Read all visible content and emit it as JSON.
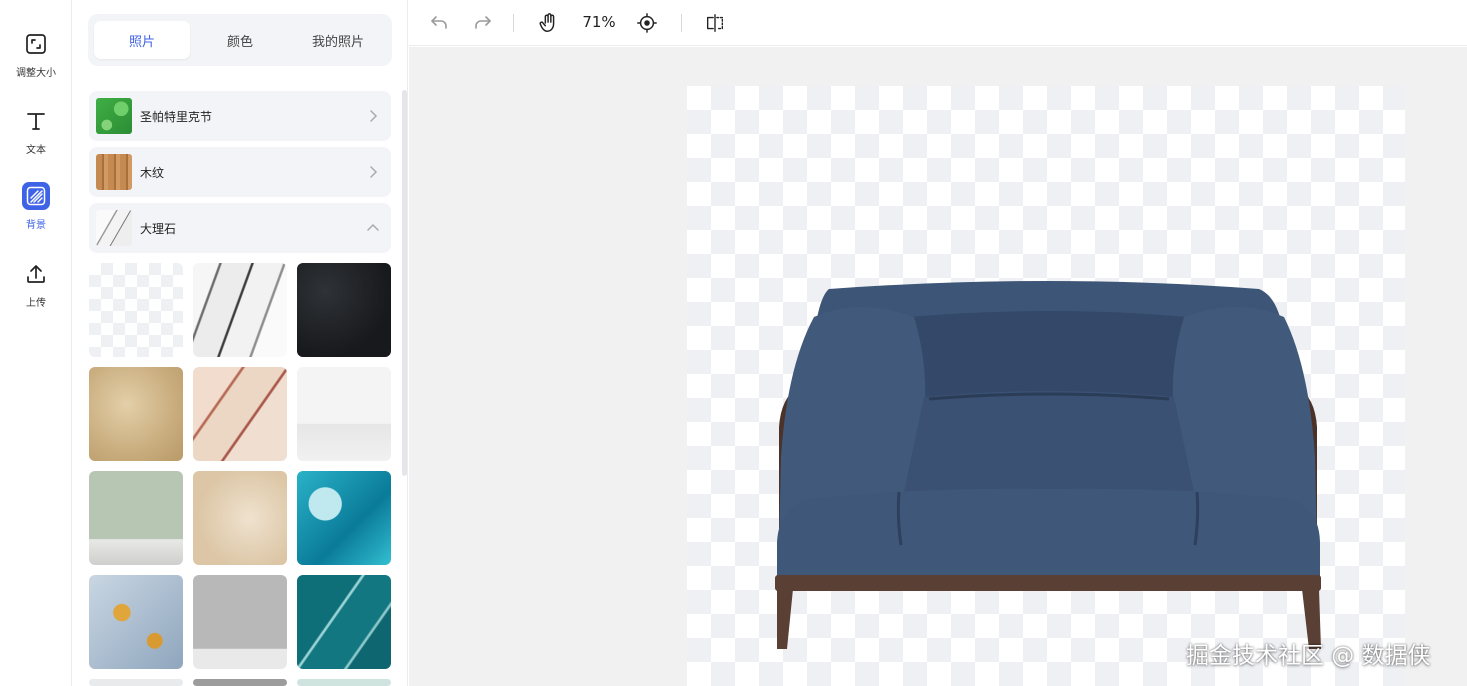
{
  "rail": {
    "items": [
      {
        "label": "调整大小",
        "icon": "resize-icon"
      },
      {
        "label": "文本",
        "icon": "text-icon"
      },
      {
        "label": "背景",
        "icon": "background-icon",
        "active": true
      },
      {
        "label": "上传",
        "icon": "upload-icon"
      }
    ]
  },
  "panel": {
    "tabs": [
      {
        "label": "照片",
        "active": true
      },
      {
        "label": "颜色"
      },
      {
        "label": "我的照片"
      }
    ],
    "categories": [
      {
        "name": "圣帕特里克节",
        "expanded": false
      },
      {
        "name": "木纹",
        "expanded": false
      },
      {
        "name": "大理石",
        "expanded": true
      }
    ]
  },
  "toolbar": {
    "zoom": "71%",
    "icons": [
      "undo-icon",
      "redo-icon",
      "hand-pan-icon",
      "crosshair-center-icon",
      "flip-compare-icon"
    ]
  },
  "watermark": "掘金技术社区 @ 数据侠",
  "colors": {
    "accent": "#3f63e6",
    "panel_bg": "#f2f4f8",
    "canvas_bg": "#f1f1f2",
    "sofa_fabric": "#3e5677",
    "sofa_frame": "#5a3f34"
  }
}
